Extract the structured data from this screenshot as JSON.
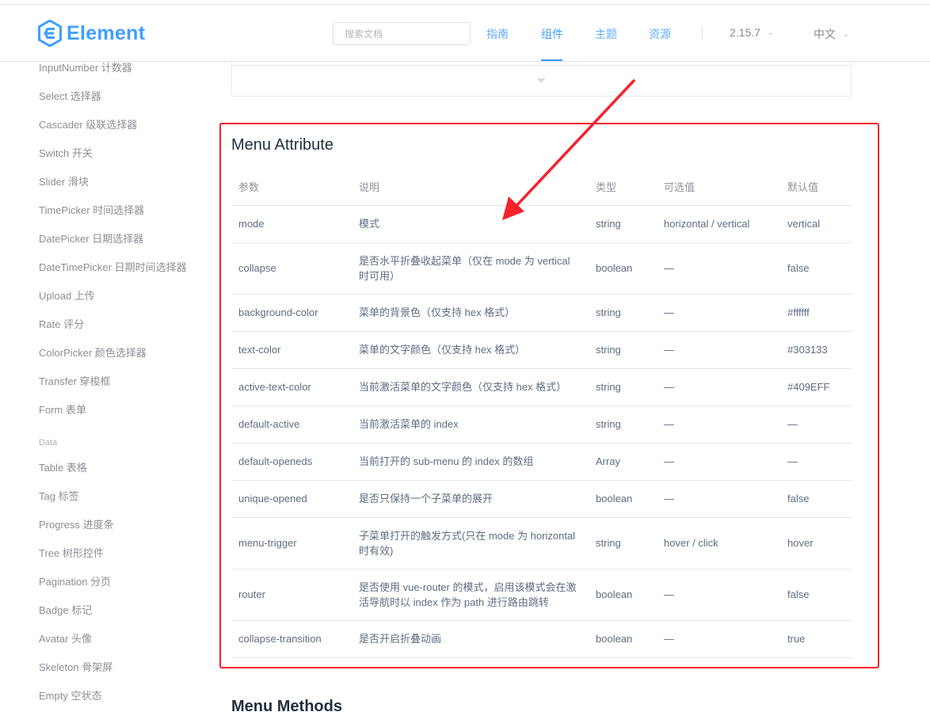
{
  "header": {
    "logo_text": "Element",
    "search_placeholder": "搜索文档",
    "nav": [
      "指南",
      "组件",
      "主题",
      "资源"
    ],
    "active_nav": "组件",
    "version": "2.15.7",
    "language": "中文"
  },
  "sidebar": {
    "items_top": [
      "InputNumber 计数器",
      "Select 选择器",
      "Cascader 级联选择器",
      "Switch 开关",
      "Slider 滑块",
      "TimePicker 时间选择器",
      "DatePicker 日期选择器",
      "DateTimePicker 日期时间选择器",
      "Upload 上传",
      "Rate 评分",
      "ColorPicker 颜色选择器",
      "Transfer 穿梭框",
      "Form 表单"
    ],
    "group_label": "Data",
    "items_data": [
      "Table 表格",
      "Tag 标签",
      "Progress 进度条",
      "Tree 树形控件",
      "Pagination 分页",
      "Badge 标记",
      "Avatar 头像",
      "Skeleton 骨架屏",
      "Empty 空状态"
    ]
  },
  "main": {
    "section_title": "Menu Attribute",
    "next_section_title": "Menu Methods",
    "columns": [
      "参数",
      "说明",
      "类型",
      "可选值",
      "默认值"
    ],
    "rows": [
      [
        "mode",
        "模式",
        "string",
        "horizontal / vertical",
        "vertical"
      ],
      [
        "collapse",
        "是否水平折叠收起菜单（仅在 mode 为 vertical 时可用）",
        "boolean",
        "—",
        "false"
      ],
      [
        "background-color",
        "菜单的背景色（仅支持 hex 格式）",
        "string",
        "—",
        "#ffffff"
      ],
      [
        "text-color",
        "菜单的文字颜色（仅支持 hex 格式）",
        "string",
        "—",
        "#303133"
      ],
      [
        "active-text-color",
        "当前激活菜单的文字颜色（仅支持 hex 格式）",
        "string",
        "—",
        "#409EFF"
      ],
      [
        "default-active",
        "当前激活菜单的 index",
        "string",
        "—",
        "—"
      ],
      [
        "default-openeds",
        "当前打开的 sub-menu 的 index 的数组",
        "Array",
        "—",
        "—"
      ],
      [
        "unique-opened",
        "是否只保持一个子菜单的展开",
        "boolean",
        "—",
        "false"
      ],
      [
        "menu-trigger",
        "子菜单打开的触发方式(只在 mode 为 horizontal 时有效)",
        "string",
        "hover / click",
        "hover"
      ],
      [
        "router",
        "是否使用 vue-router 的模式，启用该模式会在激活导航时以 index 作为 path 进行路由跳转",
        "boolean",
        "—",
        "false"
      ],
      [
        "collapse-transition",
        "是否开启折叠动画",
        "boolean",
        "—",
        "true"
      ]
    ]
  },
  "colors": {
    "brand": "#409eff",
    "annotation": "#f5222d"
  }
}
